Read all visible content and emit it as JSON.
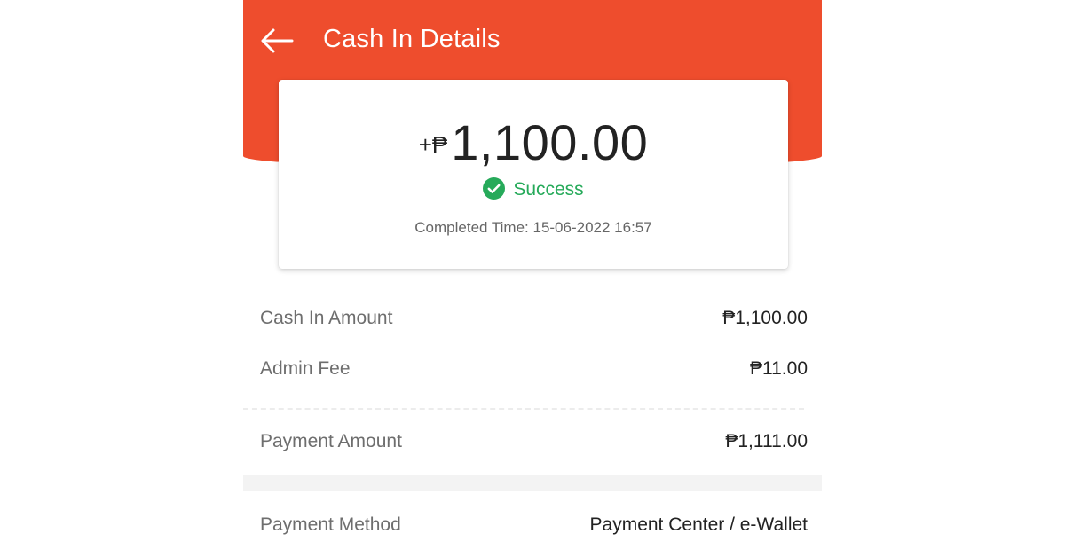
{
  "header": {
    "title": "Cash In Details",
    "back_icon": "arrow-left-icon",
    "background_color": "#ee4d2d"
  },
  "summary": {
    "amount_prefix": "+₱",
    "amount": "1,100.00",
    "status": "Success",
    "status_icon": "check-circle-icon",
    "status_color": "#26aa5a",
    "completed_time": "Completed Time: 15-06-2022 16:57"
  },
  "details": {
    "cash_in_amount": {
      "label": "Cash In Amount",
      "value": "₱1,100.00"
    },
    "admin_fee": {
      "label": "Admin Fee",
      "value": "₱11.00"
    },
    "payment_amount": {
      "label": "Payment Amount",
      "value": "₱1,111.00"
    },
    "payment_method": {
      "label": "Payment Method",
      "value": "Payment Center / e-Wallet"
    }
  }
}
